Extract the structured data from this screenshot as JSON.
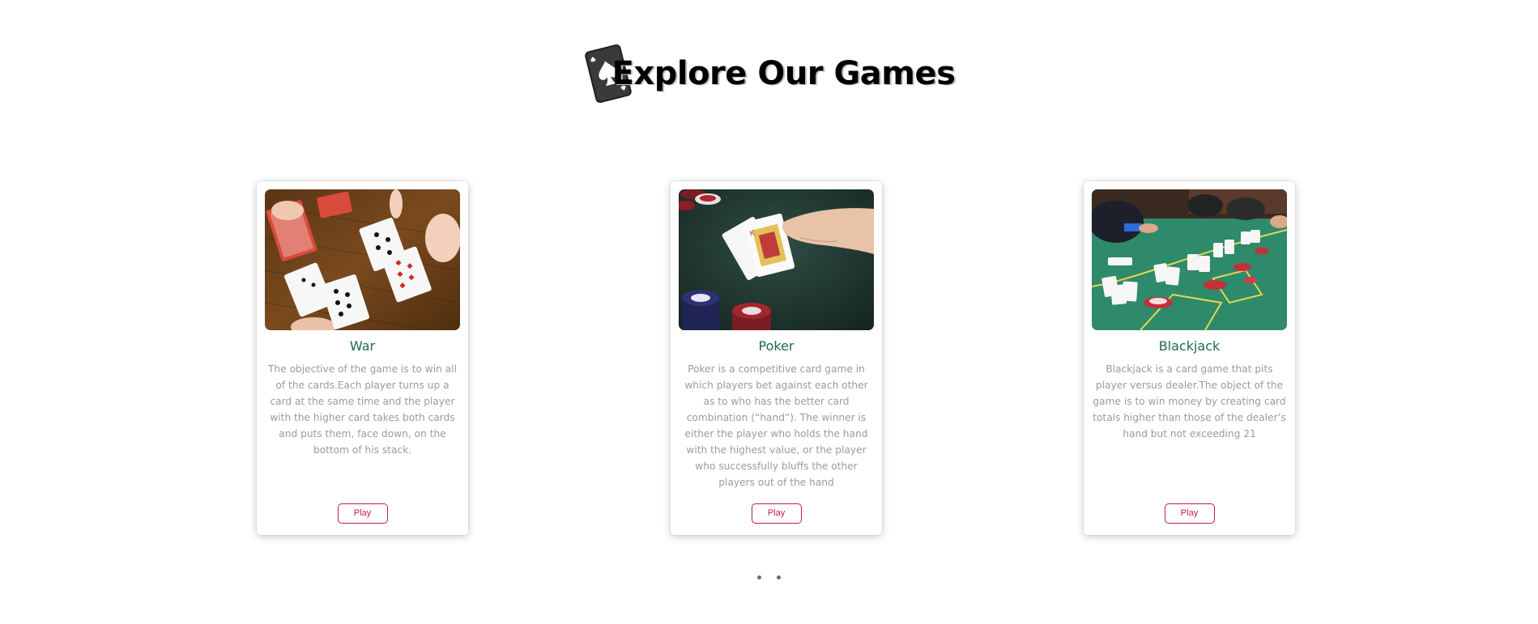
{
  "header": {
    "title": "Explore Our Games",
    "logo_icon": "spade-card-icon"
  },
  "games": [
    {
      "title": "War",
      "description": "The objective of the game is to win all of the cards.Each player turns up a card at the same time and the player with the higher card takes both cards and puts them, face down, on the bottom of his stack.",
      "play_label": "Play",
      "image": "war-card-game-photo"
    },
    {
      "title": "Poker",
      "description": "Poker is a competitive card game in which players bet against each other as to who has the better card combination (“hand”). The winner is either the player who holds the hand with the highest value, or the player who successfully bluffs the other players out of the hand",
      "play_label": "Play",
      "image": "poker-hand-photo"
    },
    {
      "title": "Blackjack",
      "description": "Blackjack is a card game that pits player versus dealer.The object of the game is to win money by creating card totals higher than those of the dealer’s hand but not exceeding 21",
      "play_label": "Play",
      "image": "blackjack-table-photo"
    }
  ],
  "pagination": {
    "dot_count": 2
  },
  "colors": {
    "title_green": "#1e6b4a",
    "body_gray": "#9a9aa6",
    "button_accent": "#c2185b",
    "dot": "#6e6e6e"
  }
}
